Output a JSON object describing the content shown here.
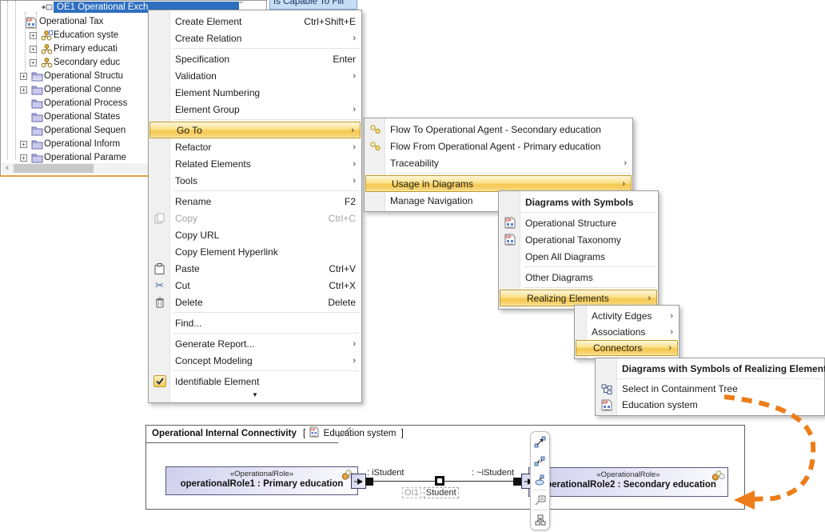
{
  "ui": {
    "submenu_arrow": "›",
    "scroll_down_arrow": "▼",
    "expand_plus": "+",
    "scrollbar_left_arrow": "‹",
    "cut_glyph": "✂"
  },
  "colors": {
    "annotation_arrow_orange": "#ED7D18",
    "menu_highlight_border": "#C29A29",
    "tree_selection_blue": "#2E6FC0",
    "panel_bottom_accent": "#E2A33F",
    "role_box_fill": "#CFCFEC"
  },
  "peek_item": {
    "label": "Is Capable To Fill"
  },
  "tree": {
    "items": [
      {
        "label": "OE1 Operational Exch"
      },
      {
        "label": "Operational Tax"
      },
      {
        "label": "Education syste"
      },
      {
        "label": "Primary educati"
      },
      {
        "label": "Secondary educ"
      },
      {
        "label": "Operational Structu"
      },
      {
        "label": "Operational Conne"
      },
      {
        "label": "Operational Process"
      },
      {
        "label": "Operational States"
      },
      {
        "label": "Operational Sequen"
      },
      {
        "label": "Operational Inform"
      },
      {
        "label": "Operational Parame"
      }
    ]
  },
  "main_menu": {
    "items": [
      {
        "label": "Create Element",
        "shortcut": "Ctrl+Shift+E"
      },
      {
        "label": "Create Relation"
      },
      {
        "label": "Specification",
        "shortcut": "Enter"
      },
      {
        "label": "Validation"
      },
      {
        "label": "Element Numbering"
      },
      {
        "label": "Element Group"
      },
      {
        "label": "Go To"
      },
      {
        "label": "Refactor"
      },
      {
        "label": "Related Elements"
      },
      {
        "label": "Tools"
      },
      {
        "label": "Rename",
        "shortcut": "F2"
      },
      {
        "label": "Copy",
        "shortcut": "Ctrl+C"
      },
      {
        "label": "Copy URL"
      },
      {
        "label": "Copy Element Hyperlink"
      },
      {
        "label": "Paste",
        "shortcut": "Ctrl+V"
      },
      {
        "label": "Cut",
        "shortcut": "Ctrl+X"
      },
      {
        "label": "Delete",
        "shortcut": "Delete"
      },
      {
        "label": "Find..."
      },
      {
        "label": "Generate Report..."
      },
      {
        "label": "Concept Modeling"
      },
      {
        "label": "Identifiable Element"
      }
    ]
  },
  "goto_menu": {
    "items": [
      {
        "label": "Flow To Operational Agent - Secondary education"
      },
      {
        "label": "Flow From Operational Agent - Primary education"
      },
      {
        "label": "Traceability"
      },
      {
        "label": "Usage in Diagrams"
      },
      {
        "label": "Manage Navigation"
      }
    ]
  },
  "usage_menu": {
    "header": "Diagrams with Symbols",
    "items": [
      {
        "label": "Operational Structure"
      },
      {
        "label": "Operational Taxonomy"
      },
      {
        "label": "Open All Diagrams"
      },
      {
        "label": "Other Diagrams"
      },
      {
        "label": "Realizing Elements"
      }
    ]
  },
  "realizing_menu": {
    "items": [
      {
        "label": "Activity Edges"
      },
      {
        "label": "Associations"
      },
      {
        "label": "Connectors"
      }
    ]
  },
  "connectors_menu": {
    "header": "Diagrams with Symbols of Realizing Elements",
    "items": [
      {
        "label": "Select in Containment Tree"
      },
      {
        "label": "Education system"
      }
    ]
  },
  "diagram": {
    "title": "Operational Internal Connectivity",
    "bracket_open": "[",
    "frame_diagram_name": "Education system",
    "bracket_close": "]",
    "role1": {
      "stereotype": "«OperationalRole»",
      "name": "operationalRole1 : Primary education"
    },
    "role2": {
      "stereotype": "«OperationalRole»",
      "name": "operationalRole2 : Secondary education"
    },
    "connector": {
      "left_label": ": iStudent",
      "right_label": ": ~iStudent",
      "mid_id": "OI1",
      "mid_name": "Student"
    }
  }
}
